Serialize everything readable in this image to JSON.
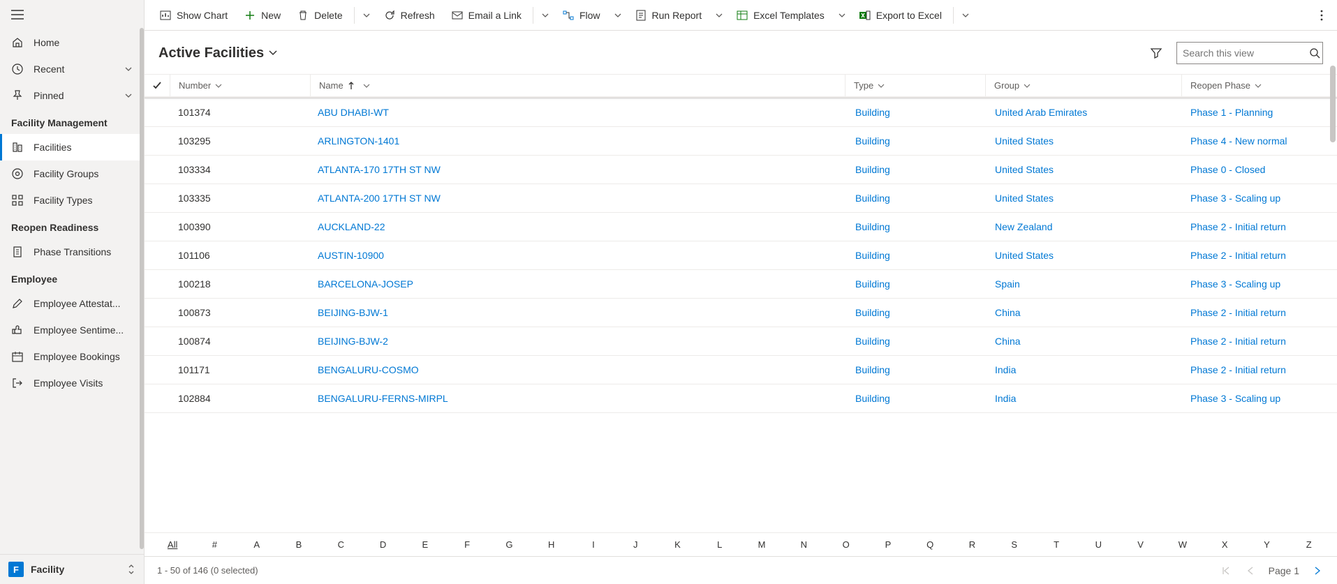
{
  "sidebar": {
    "top": [
      {
        "label": "Home",
        "icon": "home"
      },
      {
        "label": "Recent",
        "icon": "clock",
        "expandable": true
      },
      {
        "label": "Pinned",
        "icon": "pin",
        "expandable": true
      }
    ],
    "sections": [
      {
        "label": "Facility Management",
        "items": [
          {
            "label": "Facilities",
            "icon": "building",
            "active": true
          },
          {
            "label": "Facility Groups",
            "icon": "location"
          },
          {
            "label": "Facility Types",
            "icon": "grid"
          }
        ]
      },
      {
        "label": "Reopen Readiness",
        "items": [
          {
            "label": "Phase Transitions",
            "icon": "page"
          }
        ]
      },
      {
        "label": "Employee",
        "items": [
          {
            "label": "Employee Attestat...",
            "icon": "pencil"
          },
          {
            "label": "Employee Sentime...",
            "icon": "thumbsup"
          },
          {
            "label": "Employee Bookings",
            "icon": "calendar"
          },
          {
            "label": "Employee Visits",
            "icon": "exit"
          }
        ]
      }
    ],
    "footer": {
      "badge": "F",
      "label": "Facility"
    }
  },
  "commands": {
    "show_chart": "Show Chart",
    "new": "New",
    "delete": "Delete",
    "refresh": "Refresh",
    "email": "Email a Link",
    "flow": "Flow",
    "run_report": "Run Report",
    "excel_templates": "Excel Templates",
    "export_excel": "Export to Excel"
  },
  "view": {
    "title": "Active Facilities",
    "search_placeholder": "Search this view"
  },
  "columns": {
    "number": "Number",
    "name": "Name",
    "type": "Type",
    "group": "Group",
    "phase": "Reopen Phase"
  },
  "rows": [
    {
      "number": "101374",
      "name": "ABU DHABI-WT",
      "type": "Building",
      "group": "United Arab Emirates",
      "phase": "Phase 1 - Planning"
    },
    {
      "number": "103295",
      "name": "ARLINGTON-1401",
      "type": "Building",
      "group": "United States",
      "phase": "Phase 4 - New normal"
    },
    {
      "number": "103334",
      "name": "ATLANTA-170 17TH ST NW",
      "type": "Building",
      "group": "United States",
      "phase": "Phase 0 - Closed"
    },
    {
      "number": "103335",
      "name": "ATLANTA-200 17TH ST NW",
      "type": "Building",
      "group": "United States",
      "phase": "Phase 3 - Scaling up"
    },
    {
      "number": "100390",
      "name": "AUCKLAND-22",
      "type": "Building",
      "group": "New Zealand",
      "phase": "Phase 2 - Initial return"
    },
    {
      "number": "101106",
      "name": "AUSTIN-10900",
      "type": "Building",
      "group": "United States",
      "phase": "Phase 2 - Initial return"
    },
    {
      "number": "100218",
      "name": "BARCELONA-JOSEP",
      "type": "Building",
      "group": "Spain",
      "phase": "Phase 3 - Scaling up"
    },
    {
      "number": "100873",
      "name": "BEIJING-BJW-1",
      "type": "Building",
      "group": "China",
      "phase": "Phase 2 - Initial return"
    },
    {
      "number": "100874",
      "name": "BEIJING-BJW-2",
      "type": "Building",
      "group": "China",
      "phase": "Phase 2 - Initial return"
    },
    {
      "number": "101171",
      "name": "BENGALURU-COSMO",
      "type": "Building",
      "group": "India",
      "phase": "Phase 2 - Initial return"
    },
    {
      "number": "102884",
      "name": "BENGALURU-FERNS-MIRPL",
      "type": "Building",
      "group": "India",
      "phase": "Phase 3 - Scaling up"
    }
  ],
  "alpha": [
    "All",
    "#",
    "A",
    "B",
    "C",
    "D",
    "E",
    "F",
    "G",
    "H",
    "I",
    "J",
    "K",
    "L",
    "M",
    "N",
    "O",
    "P",
    "Q",
    "R",
    "S",
    "T",
    "U",
    "V",
    "W",
    "X",
    "Y",
    "Z"
  ],
  "footer": {
    "status": "1 - 50 of 146 (0 selected)",
    "page": "Page 1"
  }
}
